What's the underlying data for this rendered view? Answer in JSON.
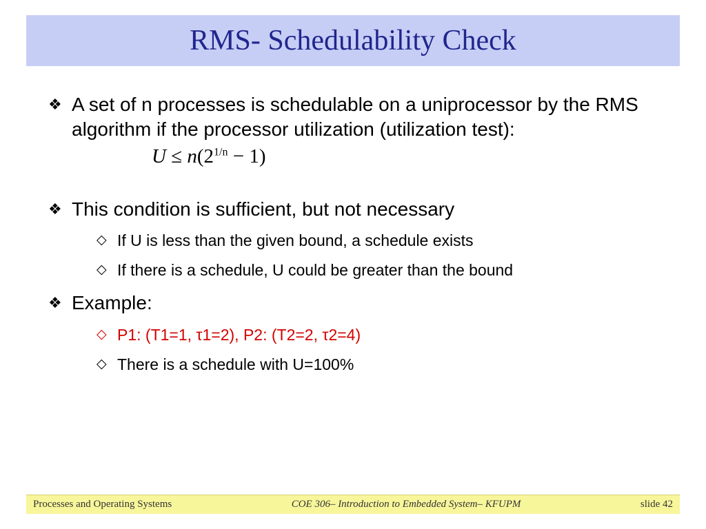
{
  "title": "RMS- Schedulability Check",
  "items": [
    {
      "level": 1,
      "text": "A set of n processes is schedulable on a uniprocessor by the RMS algorithm if the processor utilization (utilization test):"
    }
  ],
  "formula": {
    "lhs": "U",
    "op": "≤",
    "rhs_a": "n",
    "rhs_b": "(2",
    "rhs_exp": "1/n",
    "rhs_c": " − 1)"
  },
  "items2": [
    {
      "level": 1,
      "text": "This condition is sufficient, but not necessary"
    },
    {
      "level": 2,
      "text": "If U is less than the given bound, a schedule exists"
    },
    {
      "level": 2,
      "text": "If there is a schedule, U could be greater than the bound"
    },
    {
      "level": 1,
      "text": "Example:"
    },
    {
      "level": 2,
      "red": true,
      "text": "P1: (T1=1, τ1=2), P2: (T2=2, τ2=4)"
    },
    {
      "level": 2,
      "text": "There is a schedule with U=100%"
    }
  ],
  "footer": {
    "left": "Processes and Operating Systems",
    "center": "COE 306– Introduction to Embedded System– KFUPM",
    "right": "slide 42"
  }
}
